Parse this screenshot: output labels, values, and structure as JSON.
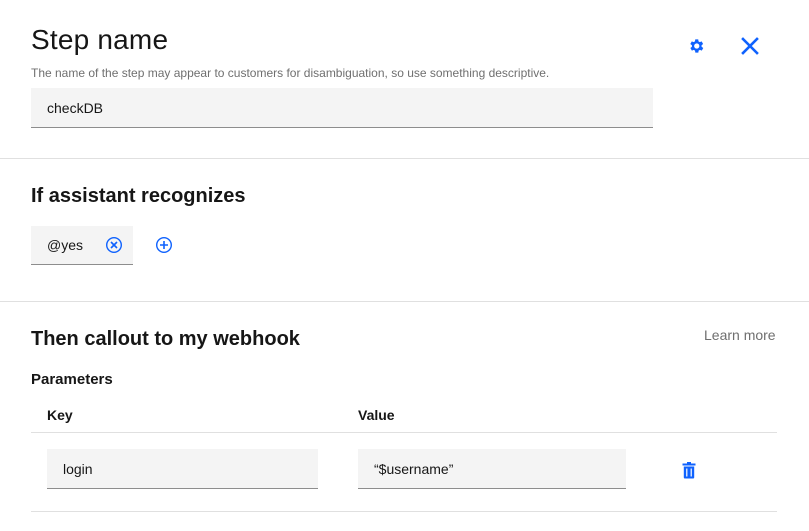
{
  "header": {
    "title": "Step name",
    "hint": "The name of the step may appear to customers for disambiguation, so use something descriptive.",
    "step_name_value": "checkDB",
    "icons": {
      "settings": "gear-icon",
      "close": "close-icon"
    }
  },
  "condition": {
    "heading": "If assistant recognizes",
    "chips": [
      {
        "label": "@yes"
      }
    ],
    "icons": {
      "remove": "close-outline-icon",
      "add": "add-circle-icon"
    }
  },
  "webhook": {
    "heading": "Then callout to my webhook",
    "learn_more": "Learn more",
    "parameters_heading": "Parameters",
    "columns": {
      "key": "Key",
      "value": "Value"
    },
    "rows": [
      {
        "key": "login",
        "value": "“$username”"
      }
    ],
    "icons": {
      "delete": "trash-icon"
    }
  },
  "colors": {
    "accent": "#0f62fe",
    "field_bg": "#f4f4f4",
    "divider": "#e0e0e0",
    "text_primary": "#161616",
    "text_secondary": "#6f6f6f"
  }
}
